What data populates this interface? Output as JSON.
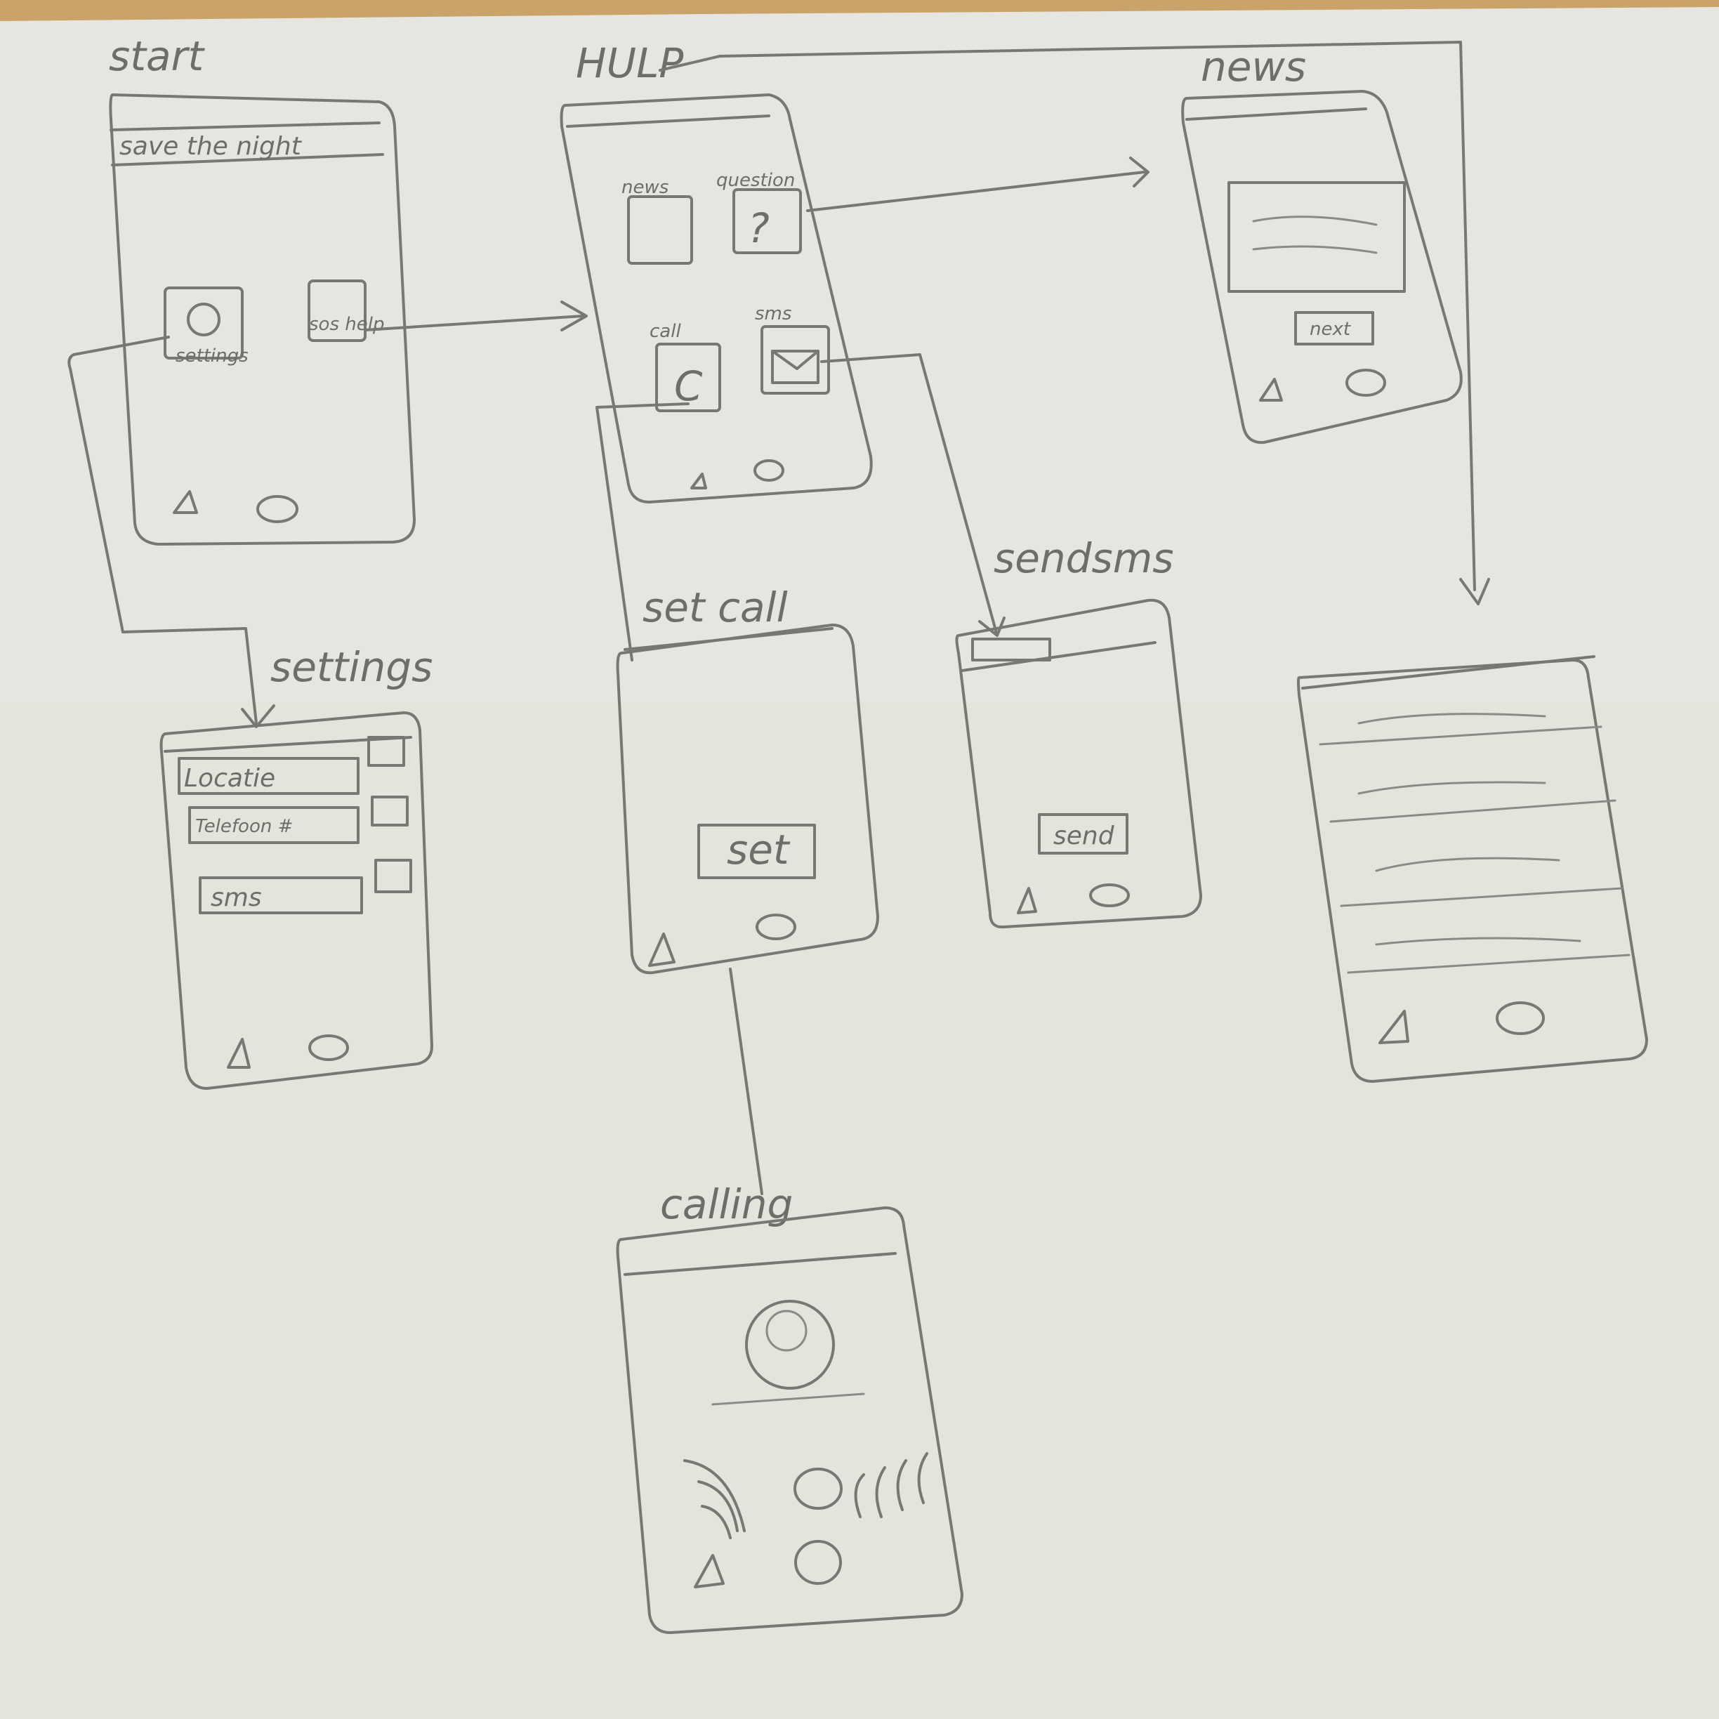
{
  "screens": {
    "start": {
      "title": "start",
      "header": "save the night",
      "icons": [
        "settings",
        "sos help"
      ]
    },
    "help": {
      "title": "HULP",
      "icons": [
        "news",
        "question",
        "call",
        "sms"
      ]
    },
    "news": {
      "title": "news",
      "button": "next"
    },
    "settings": {
      "title": "settings",
      "fields": [
        "Locatie",
        "Telefoon #",
        "sms"
      ]
    },
    "setcall": {
      "title": "set call",
      "button": "set"
    },
    "sendsms": {
      "title": "sendsms",
      "button": "send"
    },
    "calling": {
      "title": "calling"
    }
  },
  "colors": {
    "paper": "#e8e6e0",
    "pencil": "#777774",
    "desk": "#c9a36a"
  }
}
